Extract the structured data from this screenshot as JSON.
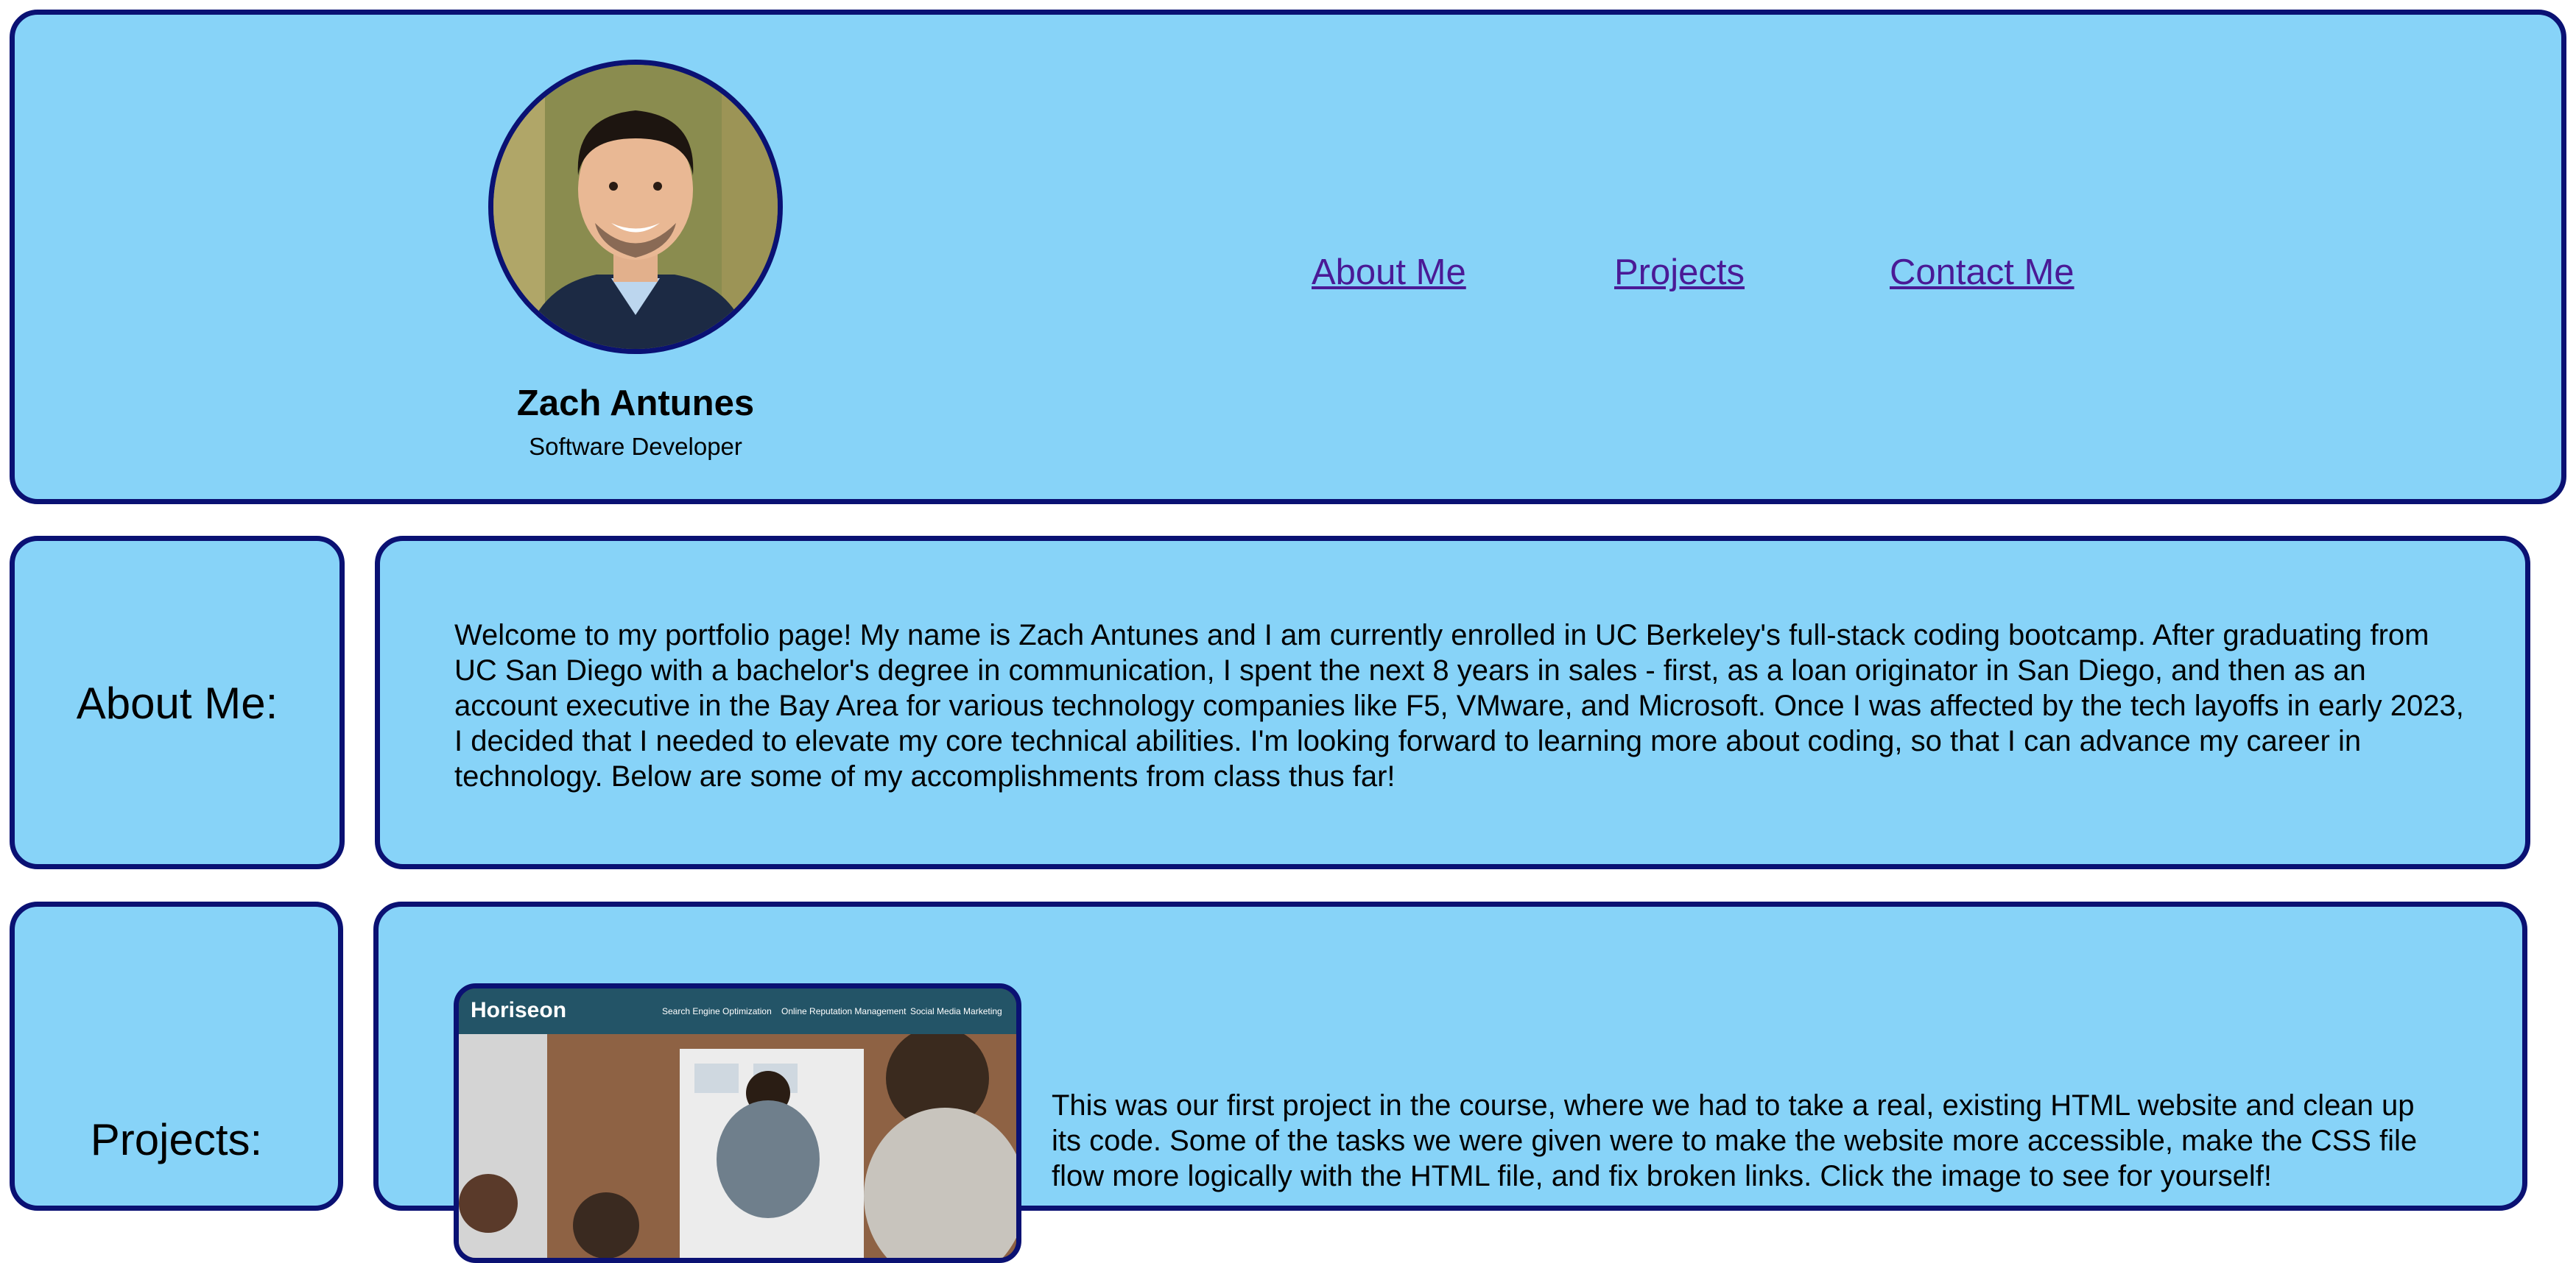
{
  "header": {
    "name": "Zach Antunes",
    "role": "Software Developer",
    "nav": {
      "about": "About Me",
      "projects": "Projects",
      "contact": "Contact Me"
    }
  },
  "about": {
    "label": "About Me:",
    "text": "Welcome to my portfolio page! My name is Zach Antunes and I am currently enrolled in UC Berkeley's full-stack coding bootcamp. After graduating from UC San Diego with a bachelor's degree in communication, I spent the next 8 years in sales - first, as a loan originator in San Diego, and then as an account executive in the Bay Area for various technology companies like F5, VMware, and Microsoft. Once I was affected by the tech layoffs in early 2023, I decided that I needed to elevate my core technical abilities. I'm looking forward to learning more about coding, so that I can advance my career in technology. Below are some of my accomplishments from class thus far!"
  },
  "projects": {
    "label": "Projects:",
    "items": [
      {
        "thumb_logo": "Horiseon",
        "thumb_nav": [
          "Search Engine Optimization",
          "Online Reputation Management",
          "Social Media Marketing"
        ],
        "text": "This was our first project in the course, where we had to take a real, existing HTML website and clean up its code. Some of the tasks we were given were to make the website more accessible, make the CSS file flow more logically with the HTML file, and fix broken links. Click the image to see for yourself!"
      }
    ]
  },
  "colors": {
    "card_bg": "#87d3f8",
    "card_border": "#0a1173",
    "link": "#4a1a96"
  }
}
